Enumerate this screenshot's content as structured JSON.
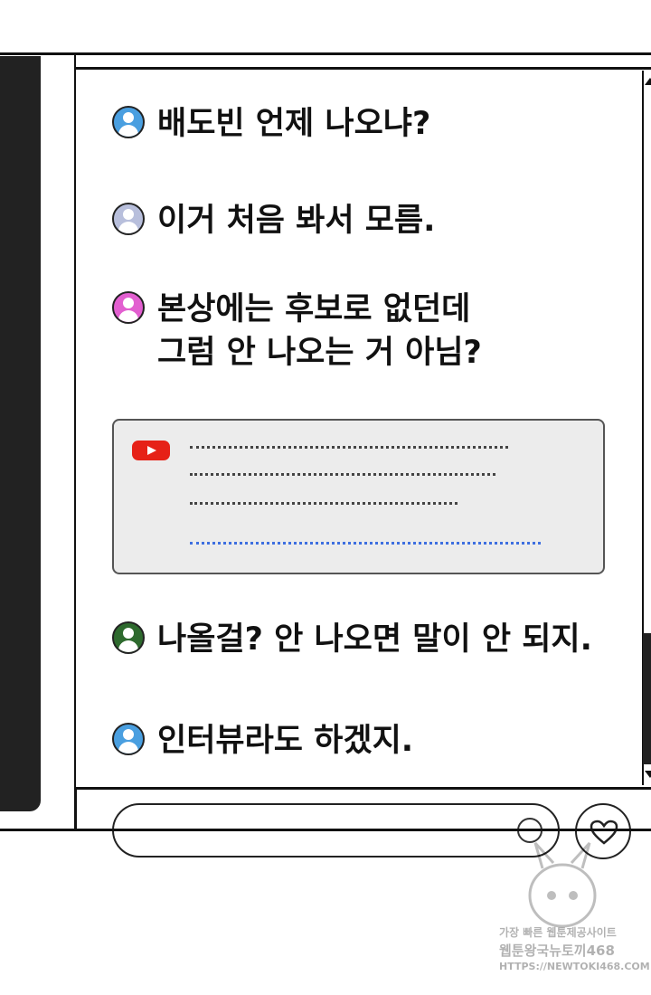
{
  "comments": [
    {
      "text": "배도빈 언제 나오냐?",
      "avatar_color": "#4a9fe0"
    },
    {
      "text": "이거 처음 봐서 모름.",
      "avatar_color": "#b8bfdc"
    },
    {
      "text": "본상에는 후보로 없던데\n그럼 안 나오는 거 아님?",
      "avatar_color": "#e25fd0"
    },
    {
      "text": "나올걸? 안 나오면 말이 안 되지.",
      "avatar_color": "#2e6a2e"
    },
    {
      "text": "인터뷰라도 하겠지.",
      "avatar_color": "#4a9fe0"
    }
  ],
  "youtube_card": {
    "icon": "youtube-icon",
    "brand_color": "#e62117",
    "link_color": "#3d6fe0"
  },
  "watermark": {
    "line1": "가장 빠른 웹툰제공사이트",
    "line2": "웹툰왕국뉴토끼468",
    "line3": "HTTPS://NEWTOKI468.COM"
  }
}
